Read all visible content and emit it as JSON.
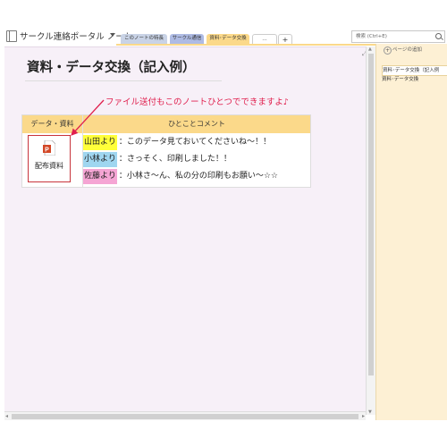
{
  "window": {
    "notebook_title": "サークル連絡ポータル ノート",
    "tabs": [
      "このノートの特長",
      "サークル通信",
      "資料･データ交換",
      "…"
    ],
    "add_tab": "+",
    "search_placeholder": "検索 (Ctrl+E)"
  },
  "page": {
    "title": "資料・データ交換（記入例）",
    "annotation": "ファイル送付もこのノートひとつでできますよ♪"
  },
  "table": {
    "headers": [
      "データ・資料",
      "ひとことコメント"
    ],
    "file_label": "配布資料",
    "rows": [
      {
        "name": "山田より",
        "comment": "：このデータ見ておいてくださいね～！！",
        "color": "#ffff3a"
      },
      {
        "name": "小林より",
        "comment": "：さっそく、印刷しました！！",
        "color": "#9fd6f0"
      },
      {
        "name": "佐藤より",
        "comment": "：小林さ～ん、私の分の印刷もお願い～☆☆",
        "color": "#f5a5d4"
      }
    ]
  },
  "side_panel": {
    "add_page_label": "ページの追加",
    "pages": [
      "資料･データ交換（記入例",
      "資料･データ交換"
    ]
  },
  "colors": {
    "page_background": "#f7f0f8",
    "table_header": "#fbd98a",
    "annotation": "#e0204e",
    "file_border": "#c8343c",
    "side_panel": "#fdf0d4"
  }
}
